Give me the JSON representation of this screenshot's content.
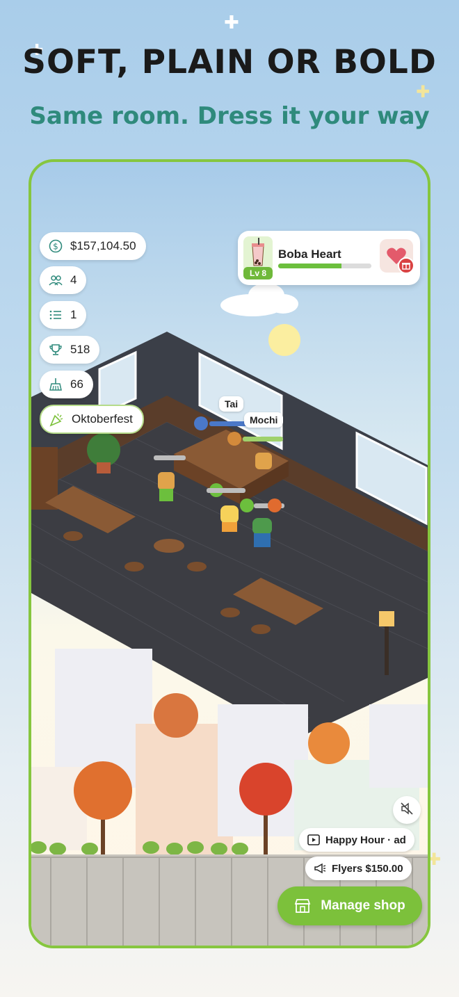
{
  "headline": "SOFT, PLAIN OR BOLD",
  "subheadline": "Same room. Dress it your way",
  "stats": {
    "money": "$157,104.50",
    "customers": "4",
    "orders": "1",
    "trophies": "518",
    "cleanliness": "66",
    "event": "Oktoberfest"
  },
  "shop_card": {
    "name": "Boba Heart",
    "level": "Lv 8",
    "progress": 0.68
  },
  "characters": {
    "name1": "Tai",
    "name2": "Mochi"
  },
  "actions": {
    "happy_hour": "Happy Hour · ad",
    "flyers": "Flyers $150.00",
    "manage_shop": "Manage shop"
  },
  "icons": {
    "money": "dollar-circle-icon",
    "customers": "people-icon",
    "orders": "list-icon",
    "trophies": "trophy-icon",
    "cleanliness": "broom-icon",
    "event": "confetti-icon",
    "mute": "speaker-muted-icon",
    "happy_hour": "play-video-icon",
    "flyers": "megaphone-icon",
    "manage_shop": "storefront-icon"
  },
  "colors": {
    "accent_green": "#7cc13b",
    "subheadline_teal": "#2f8a7c",
    "frame_border": "#86c63f"
  }
}
